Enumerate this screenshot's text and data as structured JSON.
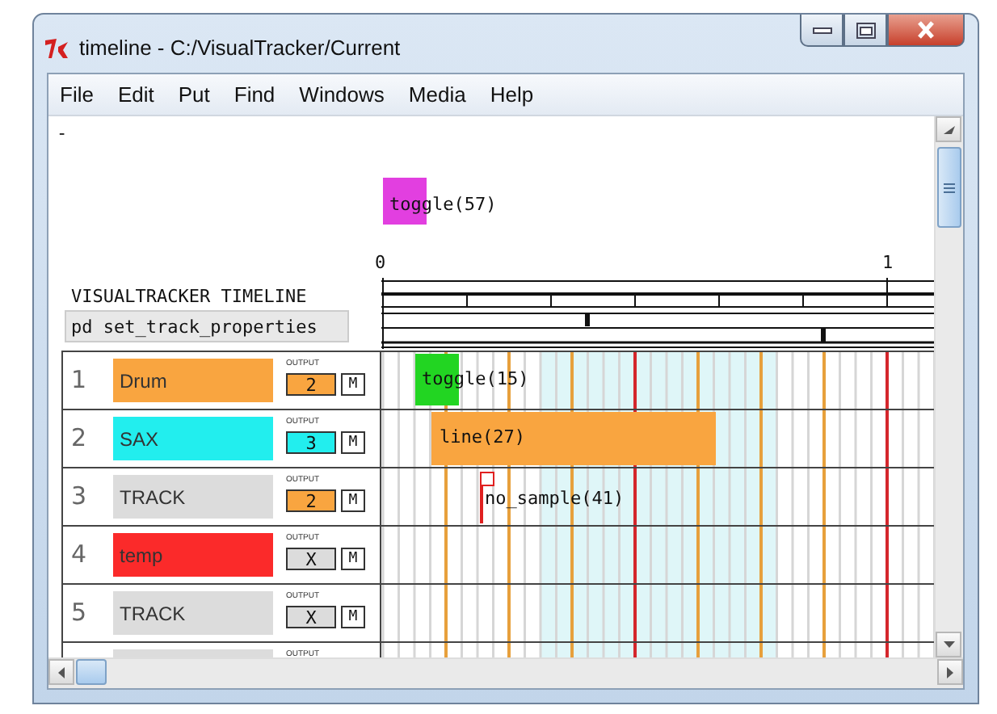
{
  "window": {
    "title": "timeline  - C:/VisualTracker/Current"
  },
  "menu": [
    "File",
    "Edit",
    "Put",
    "Find",
    "Windows",
    "Media",
    "Help"
  ],
  "canvas": {
    "dash": "-",
    "object": {
      "label": "toggle(57)",
      "color": "#e23fe0"
    },
    "ruler": {
      "start": "0",
      "end": "1"
    },
    "heading": "VISUALTRACKER TIMELINE",
    "subpatch": "pd set_track_properties",
    "tracks": [
      {
        "number": "1",
        "name": "Drum",
        "color": "#f9a540",
        "output_caption": "OUTPUT",
        "output": {
          "value": "2",
          "color": "#f9a540"
        },
        "mute": "M",
        "clip": {
          "kind": "toggle",
          "label": "toggle(15)",
          "color": "#22d522"
        }
      },
      {
        "number": "2",
        "name": "SAX",
        "color": "#22eeee",
        "output_caption": "OUTPUT",
        "output": {
          "value": "3",
          "color": "#22eeee"
        },
        "mute": "M",
        "clip": {
          "kind": "line",
          "label": "line(27)",
          "color": "#f9a540"
        }
      },
      {
        "number": "3",
        "name": "TRACK",
        "color": "#dcdcdc",
        "output_caption": "OUTPUT",
        "output": {
          "value": "2",
          "color": "#f9a540"
        },
        "mute": "M",
        "clip": {
          "kind": "marker",
          "label": "no_sample(41)",
          "color": "#e02020"
        }
      },
      {
        "number": "4",
        "name": "temp",
        "color": "#fb2a2a",
        "output_caption": "OUTPUT",
        "output": {
          "value": "X",
          "color": "#dcdcdc"
        },
        "mute": "M"
      },
      {
        "number": "5",
        "name": "TRACK",
        "color": "#dcdcdc",
        "output_caption": "OUTPUT",
        "output": {
          "value": "X",
          "color": "#dcdcdc"
        },
        "mute": "M"
      },
      {
        "color": "#dcdcdc",
        "output_caption": "OUTPUT"
      }
    ]
  }
}
